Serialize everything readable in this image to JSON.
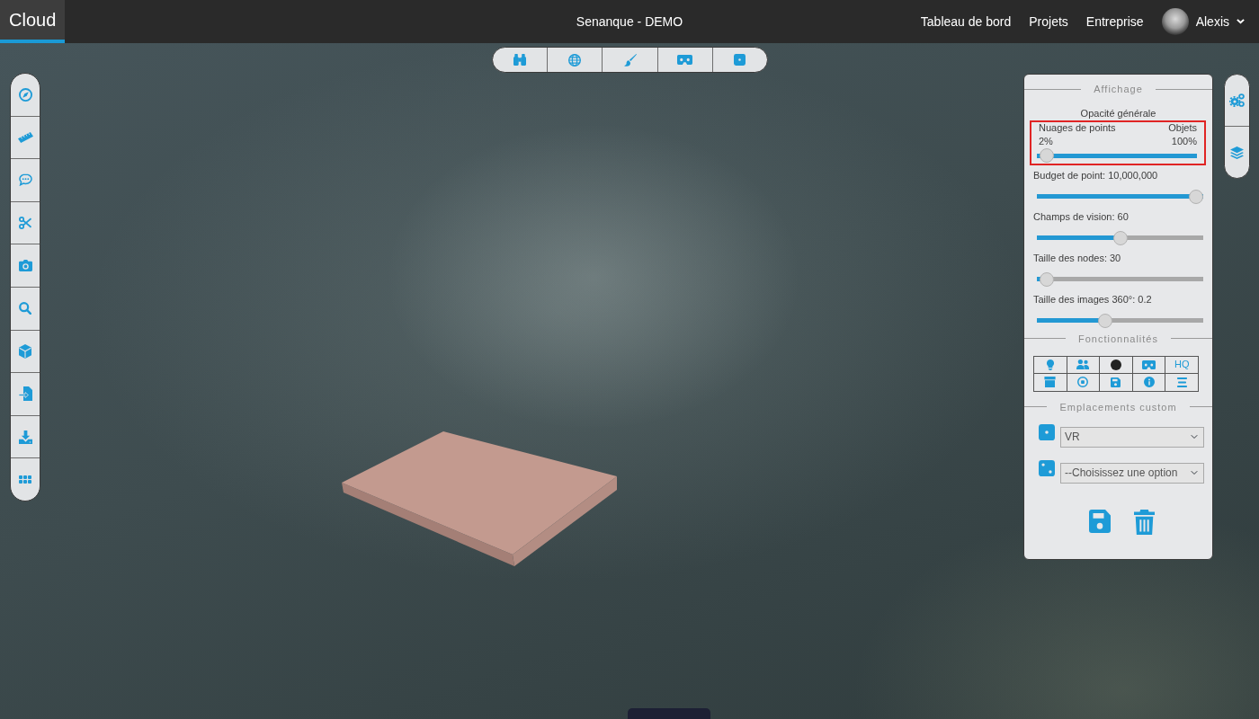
{
  "navbar": {
    "brand": "Cloud",
    "title": "Senanque - DEMO",
    "links": [
      {
        "label": "Tableau de bord"
      },
      {
        "label": "Projets"
      },
      {
        "label": "Entreprise"
      }
    ],
    "user": {
      "name": "Alexis"
    }
  },
  "settings_panel": {
    "display": {
      "title": "Affichage",
      "opacity": {
        "title": "Opacité générale",
        "left_label": "Nuages de points",
        "right_label": "Objets",
        "left_value": "2%",
        "right_value": "100%",
        "level": 0.02,
        "highlighted": true
      },
      "sliders": [
        {
          "label": "Budget de point: 10,000,000",
          "level": 1
        },
        {
          "label": "Champs de vision: 60",
          "level": 0.5
        },
        {
          "label": "Taille des nodes: 30",
          "level": 0.02
        },
        {
          "label": "Taille des images 360°: 0.2",
          "level": 0.4
        }
      ]
    },
    "features": {
      "title": "Fonctionnalités",
      "quality_button": "HQ"
    },
    "custom_locations": {
      "title": "Emplacements custom",
      "selects": [
        {
          "value": "VR"
        },
        {
          "value": "--Choisissez une option"
        }
      ]
    }
  }
}
